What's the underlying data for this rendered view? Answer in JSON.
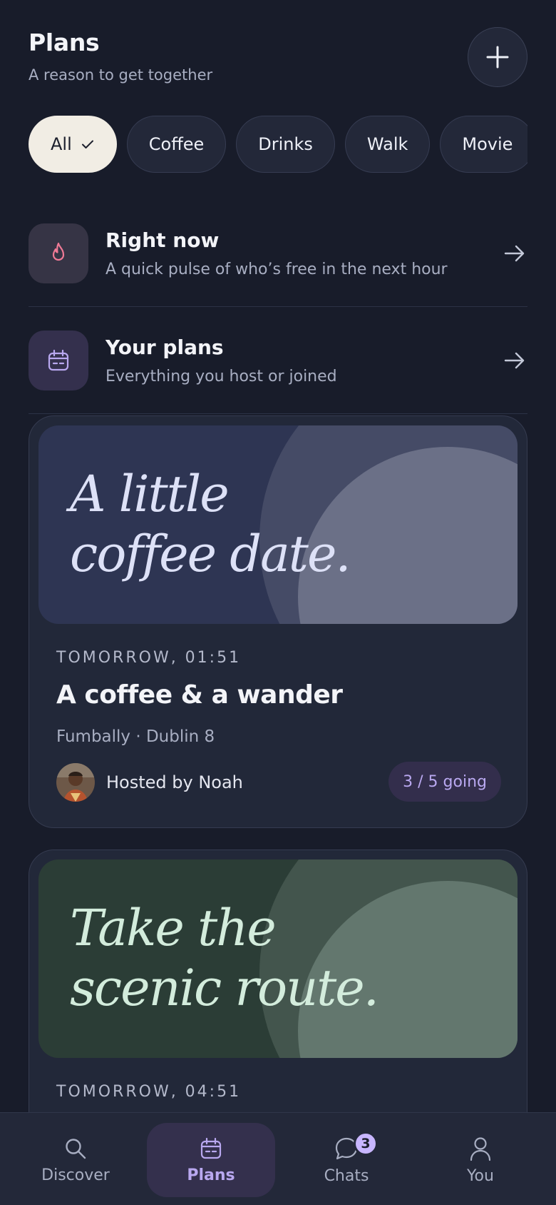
{
  "header": {
    "title": "Plans",
    "subtitle": "A reason to get together"
  },
  "filters": [
    {
      "label": "All",
      "active": true
    },
    {
      "label": "Coffee",
      "active": false
    },
    {
      "label": "Drinks",
      "active": false
    },
    {
      "label": "Walk",
      "active": false
    },
    {
      "label": "Movie",
      "active": false
    }
  ],
  "rows": [
    {
      "title": "Right now",
      "subtitle": "A quick pulse of who’s free in the next hour",
      "icon": "flame-icon",
      "icon_color": "#f07a96",
      "box_color": "#363445"
    },
    {
      "title": "Your plans",
      "subtitle": "Everything you host or joined",
      "icon": "calendar-icon",
      "icon_color": "#b9a8f0",
      "box_color": "#34304d"
    }
  ],
  "plans": [
    {
      "tagline": "A little\ncoffee date.",
      "when": "TOMORROW, 01:51",
      "title": "A coffee & a wander",
      "location": "Fumbally · Dublin 8",
      "host": "Hosted by Noah",
      "going": "3 / 5 going",
      "colors": {
        "bg": "#2e3553",
        "circle_outer": "#454b66",
        "circle_inner": "#6b7087",
        "text": "#dde1f7"
      }
    },
    {
      "tagline": "Take the\nscenic route.",
      "when": "TOMORROW, 04:51",
      "colors": {
        "bg": "#2b3d36",
        "circle_outer": "#43554d",
        "circle_inner": "#63776e",
        "text": "#d3ecdc"
      }
    }
  ],
  "tabs": [
    {
      "label": "Discover",
      "icon": "search-icon",
      "active": false
    },
    {
      "label": "Plans",
      "icon": "calendar-icon",
      "active": true
    },
    {
      "label": "Chats",
      "icon": "chat-bubble-icon",
      "active": false,
      "badge": "3"
    },
    {
      "label": "You",
      "icon": "person-icon",
      "active": false
    }
  ],
  "colors": {
    "accent": "#b9a8f0",
    "background": "#181c2a",
    "surface": "#232839"
  }
}
